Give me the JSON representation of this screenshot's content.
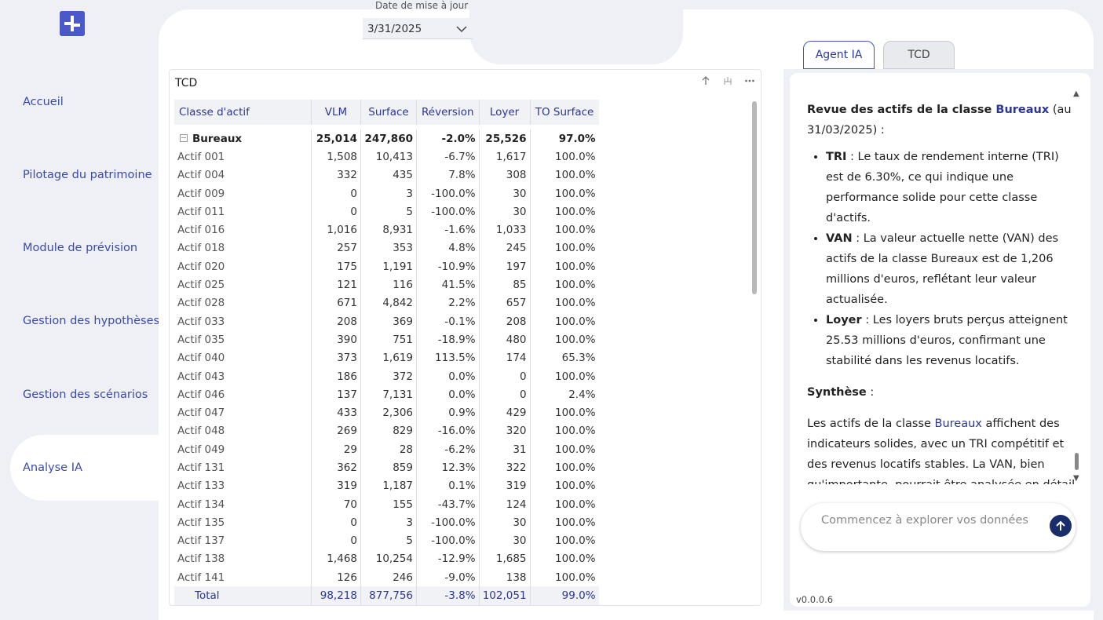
{
  "sidebar": {
    "items": [
      {
        "label": "Accueil"
      },
      {
        "label": "Pilotage du patrimoine"
      },
      {
        "label": "Module de prévision"
      },
      {
        "label": "Gestion des hypothèses"
      },
      {
        "label": "Gestion des scénarios"
      },
      {
        "label": "Analyse IA"
      }
    ],
    "active_index": 5
  },
  "date_filter": {
    "label": "Date de mise à jour",
    "value": "3/31/2025"
  },
  "tcd": {
    "title": "TCD",
    "columns": [
      "Classe d'actif",
      "VLM",
      "Surface",
      "Réversion",
      "Loyer",
      "TO Surface"
    ],
    "group": {
      "name": "Bureaux",
      "vlm": "25,014",
      "surface": "247,860",
      "reversion": "-2.0%",
      "loyer": "25,526",
      "to_surface": "97.0%"
    },
    "rows": [
      [
        "Actif 001",
        "1,508",
        "10,413",
        "-6.7%",
        "1,617",
        "100.0%"
      ],
      [
        "Actif 004",
        "332",
        "435",
        "7.8%",
        "308",
        "100.0%"
      ],
      [
        "Actif 009",
        "0",
        "3",
        "-100.0%",
        "30",
        "100.0%"
      ],
      [
        "Actif 011",
        "0",
        "5",
        "-100.0%",
        "30",
        "100.0%"
      ],
      [
        "Actif 016",
        "1,016",
        "8,931",
        "-1.6%",
        "1,033",
        "100.0%"
      ],
      [
        "Actif 018",
        "257",
        "353",
        "4.8%",
        "245",
        "100.0%"
      ],
      [
        "Actif 020",
        "175",
        "1,191",
        "-10.9%",
        "197",
        "100.0%"
      ],
      [
        "Actif 025",
        "121",
        "116",
        "41.5%",
        "85",
        "100.0%"
      ],
      [
        "Actif 028",
        "671",
        "4,842",
        "2.2%",
        "657",
        "100.0%"
      ],
      [
        "Actif 033",
        "208",
        "369",
        "-0.1%",
        "208",
        "100.0%"
      ],
      [
        "Actif 035",
        "390",
        "751",
        "-18.9%",
        "480",
        "100.0%"
      ],
      [
        "Actif 040",
        "373",
        "1,619",
        "113.5%",
        "174",
        "65.3%"
      ],
      [
        "Actif 043",
        "186",
        "372",
        "0.0%",
        "0",
        "100.0%"
      ],
      [
        "Actif 046",
        "137",
        "7,131",
        "0.0%",
        "0",
        "2.4%"
      ],
      [
        "Actif 047",
        "433",
        "2,306",
        "0.9%",
        "429",
        "100.0%"
      ],
      [
        "Actif 048",
        "269",
        "829",
        "-16.0%",
        "320",
        "100.0%"
      ],
      [
        "Actif 049",
        "29",
        "28",
        "-6.2%",
        "31",
        "100.0%"
      ],
      [
        "Actif 131",
        "362",
        "859",
        "12.3%",
        "322",
        "100.0%"
      ],
      [
        "Actif 133",
        "319",
        "1,187",
        "0.1%",
        "319",
        "100.0%"
      ],
      [
        "Actif 134",
        "70",
        "155",
        "-43.7%",
        "124",
        "100.0%"
      ],
      [
        "Actif 135",
        "0",
        "3",
        "-100.0%",
        "30",
        "100.0%"
      ],
      [
        "Actif 137",
        "0",
        "5",
        "-100.0%",
        "30",
        "100.0%"
      ],
      [
        "Actif 138",
        "1,468",
        "10,254",
        "-12.9%",
        "1,685",
        "100.0%"
      ],
      [
        "Actif 141",
        "126",
        "246",
        "-9.0%",
        "138",
        "100.0%"
      ]
    ],
    "total": {
      "label": "Total",
      "vlm": "98,218",
      "surface": "877,756",
      "reversion": "-3.8%",
      "loyer": "102,051",
      "to_surface": "99.0%"
    }
  },
  "tabs": {
    "agent": "Agent IA",
    "tcd": "TCD"
  },
  "chat": {
    "intro_prefix": "Revue des actifs de la classe ",
    "intro_class": "Bureaux",
    "intro_suffix": " (au 31/03/2025) :",
    "bullets": [
      {
        "term": "TRI",
        "text": " : Le taux de rendement interne (TRI) est de 6.30%, ce qui indique une performance solide pour cette classe d'actifs."
      },
      {
        "term": "VAN",
        "text": " : La valeur actuelle nette (VAN) des actifs de la classe Bureaux est de 1,206 millions d'euros, reflétant leur valeur actualisée."
      },
      {
        "term": "Loyer",
        "text": " : Les loyers bruts perçus atteignent 25.53 millions d'euros, confirmant une stabilité dans les revenus locatifs."
      }
    ],
    "synthese_title": "Synthèse",
    "synthese_suffix": " :",
    "synthese_prefix": "Les actifs de la classe ",
    "synthese_class": "Bureaux",
    "synthese_text": " affichent des indicateurs solides, avec un TRI compétitif et des revenus locatifs stables. La VAN, bien qu'importante, pourrait être analysée en détail",
    "input_placeholder": "Commencez à explorer vos données"
  },
  "version": "v0.0.0.6",
  "colors": {
    "accent": "#2b3696",
    "logo": "#4a58c8",
    "send_button": "#1a2d6b",
    "background": "#eef0f6"
  }
}
